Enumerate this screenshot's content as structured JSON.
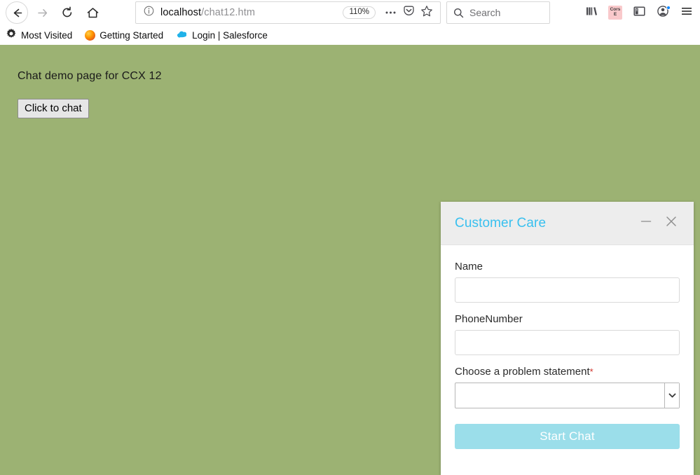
{
  "browser": {
    "nav": {
      "back_icon": "back-arrow-icon",
      "forward_icon": "forward-arrow-icon",
      "reload_icon": "reload-icon",
      "home_icon": "home-icon"
    },
    "urlbar": {
      "info_icon": "info-icon",
      "url_host": "localhost",
      "url_path": "/chat12.htm",
      "zoom_level": "110%",
      "page_actions_icon": "ellipsis-icon",
      "pocket_icon": "pocket-icon",
      "bookmark_star_icon": "star-icon"
    },
    "search": {
      "icon": "search-icon",
      "placeholder": "Search",
      "value": ""
    },
    "toolbar_right": {
      "library_icon": "library-icon",
      "cors_badge_line1": "Cors",
      "cors_badge_line2": "E",
      "sidebar_icon": "sidebar-icon",
      "account_icon": "account-icon",
      "menu_icon": "hamburger-menu-icon"
    },
    "bookmarks": [
      {
        "label": "Most Visited",
        "icon": "gear-icon"
      },
      {
        "label": "Getting Started",
        "icon": "firefox-icon"
      },
      {
        "label": "Login | Salesforce",
        "icon": "salesforce-cloud-icon"
      }
    ]
  },
  "page": {
    "heading": "Chat demo page for CCX 12",
    "chat_button_label": "Click to chat",
    "background_color": "#9cb273"
  },
  "chat_widget": {
    "title": "Customer Care",
    "title_color": "#39c0ef",
    "minimize_icon": "minimize-icon",
    "close_icon": "close-icon",
    "header_background": "#ededed",
    "fields": [
      {
        "label": "Name",
        "value": "",
        "placeholder": "",
        "required_marker": ""
      },
      {
        "label": "PhoneNumber",
        "value": "",
        "placeholder": "",
        "required_marker": ""
      }
    ],
    "select_field": {
      "label": "Choose a problem statement",
      "required_marker": "*",
      "selected_value": "",
      "options": [
        ""
      ],
      "arrow_icon": "chevron-down-icon"
    },
    "submit_button": {
      "label": "Start Chat",
      "color": "#9bdeea"
    }
  }
}
